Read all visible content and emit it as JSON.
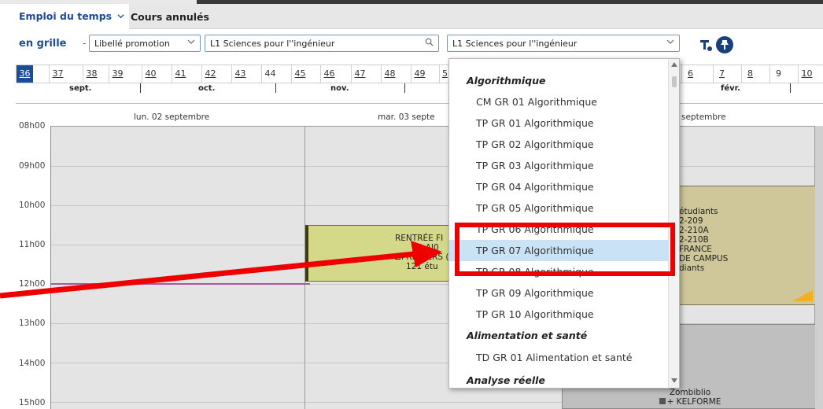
{
  "tabs": {
    "active": "Emploi du temps",
    "other": "Cours annulés"
  },
  "toolbar": {
    "grid_label": "en grille",
    "dash": "-",
    "type_select": "Libellé promotion",
    "search_value": "L1 Sciences pour l''ingénieur",
    "promo_select": "L1 Sciences pour l''ingénieur"
  },
  "weeks": [
    "36",
    "37",
    "38",
    "39",
    "40",
    "41",
    "42",
    "43",
    "44",
    "45",
    "46",
    "47",
    "48",
    "49",
    "5",
    "6",
    "7",
    "8",
    "9",
    "10"
  ],
  "months": {
    "sept": "sept.",
    "oct": "oct.",
    "nov": "nov.",
    "fevr": "févr."
  },
  "days": {
    "d1": "lun. 02 septembre",
    "d2": "mar. 03 septe",
    "d3": "septembre"
  },
  "hours": [
    "08h00",
    "09h00",
    "10h00",
    "11h00",
    "12h00",
    "13h00",
    "14h00",
    "15h00"
  ],
  "events": {
    "rentree": {
      "l1": "RENTRÉE FI",
      "l2": "10 AI0",
      "l3": "PREMIERS (",
      "l4": "121 étu"
    },
    "etudiants": {
      "l1": "étudiants",
      "l2": "2-209",
      "l3": "2-210A",
      "l4": "2-210B",
      "l5": "FRANCE",
      "l6": "DE CAMPUS",
      "l7": "diants"
    },
    "zombiblio": {
      "l1": "Zombiblio",
      "l2": "+ KELFORME"
    }
  },
  "dropdown": {
    "group1": "Algorithmique",
    "items1": [
      "CM GR 01 Algorithmique",
      "TP GR 01 Algorithmique",
      "TP GR 02 Algorithmique",
      "TP GR 03 Algorithmique",
      "TP GR 04 Algorithmique",
      "TP GR 05 Algorithmique",
      "TP GR 06 Algorithmique",
      "TP GR 07 Algorithmique",
      "TP GR 08 Algorithmique",
      "TP GR 09 Algorithmique",
      "TP GR 10 Algorithmique"
    ],
    "group2": "Alimentation et santé",
    "items2": [
      "TD GR 01 Alimentation et santé"
    ],
    "group3": "Analyse réelle",
    "highlighted": "TP GR 07 Algorithmique"
  },
  "colors": {
    "brand": "#1f4a96",
    "event_green": "#d4d98a",
    "event_tan": "#cfc79a",
    "annotation": "#ee0000"
  }
}
